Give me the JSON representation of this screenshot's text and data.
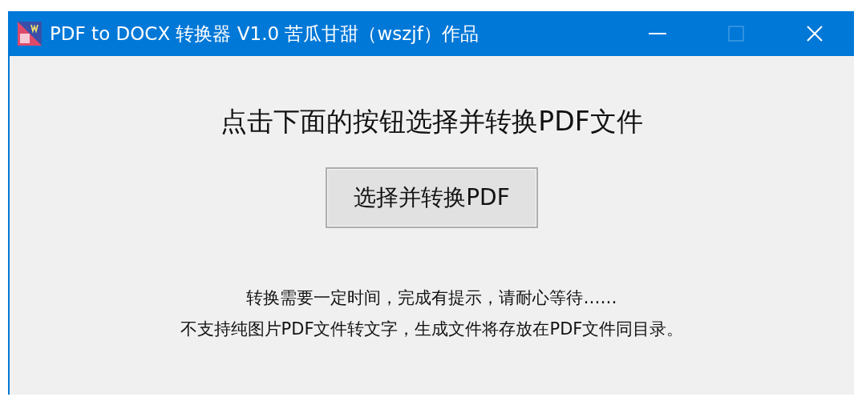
{
  "window": {
    "title": "PDF to DOCX 转换器 V1.0 苦瓜甘甜（wszjf）作品",
    "controls": [
      {
        "kind": "minimize",
        "disabled": false
      },
      {
        "kind": "maximize",
        "disabled": true
      },
      {
        "kind": "close",
        "disabled": false
      }
    ]
  },
  "heading": "点击下面的按钮选择并转换PDF文件",
  "button": "选择并转换PDF",
  "notes": [
    "转换需要一定时间，完成有提示，请耐心等待……",
    "不支持纯图片PDF文件转文字，生成文件将存放在PDF文件同目录。"
  ]
}
